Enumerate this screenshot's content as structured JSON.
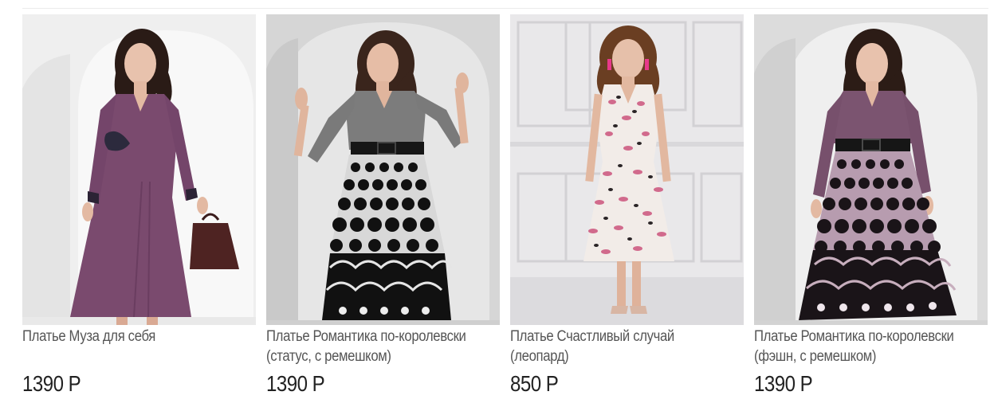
{
  "products": [
    {
      "title_lines": [
        "Платье Муза для себя"
      ],
      "price": "1390 Р",
      "photo": "woman-in-plum-dress-with-lace-and-handbag"
    },
    {
      "title_lines": [
        "Платье Романтика по-королевски",
        "(статус, с ремешком)"
      ],
      "price": "1390 Р",
      "photo": "woman-in-grey-dress-with-black-polka-dot-skirt"
    },
    {
      "title_lines": [
        "Платье Счастливый случай",
        "(леопард)"
      ],
      "price": "850 Р",
      "photo": "woman-in-pink-leopard-print-dress"
    },
    {
      "title_lines": [
        "Платье Романтика по-королевски",
        "(фэшн, с ремешком)"
      ],
      "price": "1390 Р",
      "photo": "woman-in-plum-dress-with-polka-dot-skirt"
    }
  ],
  "colors": {
    "title_text": "#555555",
    "price_text": "#222222",
    "plum": "#7a4a6e",
    "grey_top": "#7c7c7c",
    "studio_bg": "#e9e9e9"
  }
}
